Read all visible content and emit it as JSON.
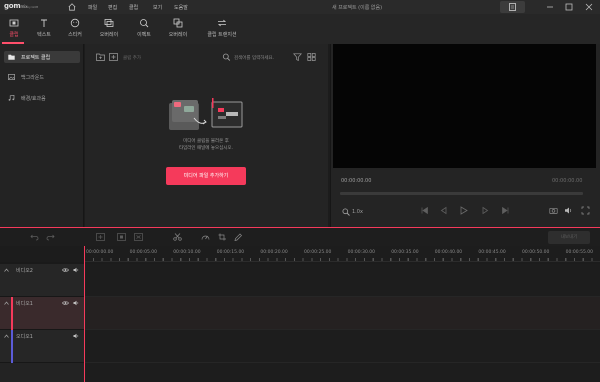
{
  "app": {
    "logo_main": "gom",
    "logo_sub": "mix",
    "logo_tag": "by GOM",
    "project_title": "새 프로젝트 (이름 없음)"
  },
  "menu": [
    "파일",
    "편집",
    "클립",
    "보기",
    "도움말"
  ],
  "tools": [
    {
      "label": "클립",
      "icon": "film-icon"
    },
    {
      "label": "텍스트",
      "icon": "text-icon"
    },
    {
      "label": "스티커",
      "icon": "sticker-icon"
    },
    {
      "label": "오버레이",
      "icon": "overlay-icon"
    },
    {
      "label": "이펙트",
      "icon": "effect-icon"
    },
    {
      "label": "오버레이",
      "icon": "layers-icon"
    },
    {
      "label": "클립 트랜지션",
      "icon": "transition-icon"
    }
  ],
  "sidebar": [
    {
      "label": "프로젝트 클립",
      "icon": "folder-icon"
    },
    {
      "label": "백그라운드",
      "icon": "image-icon"
    },
    {
      "label": "배경/효과음",
      "icon": "music-icon"
    }
  ],
  "media": {
    "clip_filter_label": "클립 추가",
    "search_placeholder": "검색어를 입력하세요.",
    "empty_line1": "미디어 클립을 불러온 후",
    "empty_line2": "타임라인 패널에 놓으십시오.",
    "add_button": "미디어 파일 추가하기"
  },
  "preview": {
    "time_current": "00:00:00.00",
    "time_total": "00:00:00.00",
    "zoom": "1.0x"
  },
  "timeline": {
    "right_button": "내보내기",
    "ticks": [
      "00:00:00.00",
      "00:00:05.00",
      "00:00:10.00",
      "00:00:15.00",
      "00:00:20.00",
      "00:00:25.00",
      "00:00:30.00",
      "00:00:35.00",
      "00:00:40.00",
      "00:00:45.00",
      "00:00:50.00",
      "00:00:55.00"
    ],
    "tracks": [
      {
        "label": "비디오2"
      },
      {
        "label": "비디오1"
      },
      {
        "label": "오디오1"
      }
    ]
  },
  "colors": {
    "accent": "#f53a5b",
    "background": "#1c1c1c"
  }
}
